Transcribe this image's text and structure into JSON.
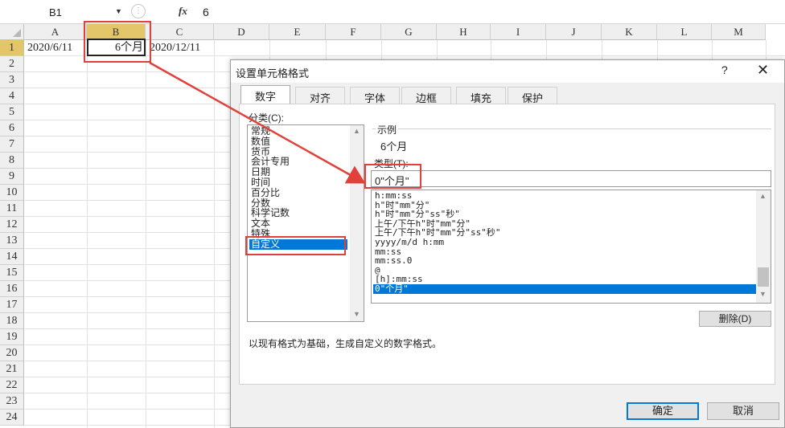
{
  "formula_bar": {
    "name_box": "B1",
    "dropdown_glyph": "▼",
    "dots": "⋮",
    "fx": "fx",
    "value": "6"
  },
  "sheet": {
    "columns": [
      "A",
      "B",
      "C",
      "D",
      "E",
      "F",
      "G",
      "H",
      "I",
      "J",
      "K",
      "L",
      "M"
    ],
    "rows": [
      "1",
      "2",
      "3",
      "4",
      "5",
      "6",
      "7",
      "8",
      "9",
      "10",
      "11",
      "12",
      "13",
      "14",
      "15",
      "16",
      "17",
      "18",
      "19",
      "20",
      "21",
      "22",
      "23",
      "24"
    ],
    "active_column": "B",
    "active_row": "1",
    "cells": {
      "A1": "2020/6/11",
      "B1": "6个月",
      "C1": "2020/12/11"
    }
  },
  "dialog": {
    "title": "设置单元格格式",
    "help": "?",
    "close": "✕",
    "tabs": [
      "数字",
      "对齐",
      "字体",
      "边框",
      "填充",
      "保护"
    ],
    "active_tab": "数字",
    "category_label": "分类(C):",
    "categories": [
      "常规",
      "数值",
      "货币",
      "会计专用",
      "日期",
      "时间",
      "百分比",
      "分数",
      "科学记数",
      "文本",
      "特殊",
      "自定义"
    ],
    "selected_category": "自定义",
    "sample_label": "示例",
    "sample_value": "6个月",
    "type_label": "类型(T):",
    "type_value": "0\"个月\"",
    "formats": [
      "h:mm:ss",
      "h\"时\"mm\"分\"",
      "h\"时\"mm\"分\"ss\"秒\"",
      "上午/下午h\"时\"mm\"分\"",
      "上午/下午h\"时\"mm\"分\"ss\"秒\"",
      "yyyy/m/d h:mm",
      "mm:ss",
      "mm:ss.0",
      "@",
      "[h]:mm:ss",
      "0\"个月\""
    ],
    "selected_format": "0\"个月\"",
    "delete_button": "删除(D)",
    "description": "以现有格式为基础，生成自定义的数字格式。",
    "ok_button": "确定",
    "cancel_button": "取消"
  },
  "colors": {
    "selection": "#0078d7",
    "annotation_red": "#e2403a",
    "active_header": "#e3c56a"
  }
}
